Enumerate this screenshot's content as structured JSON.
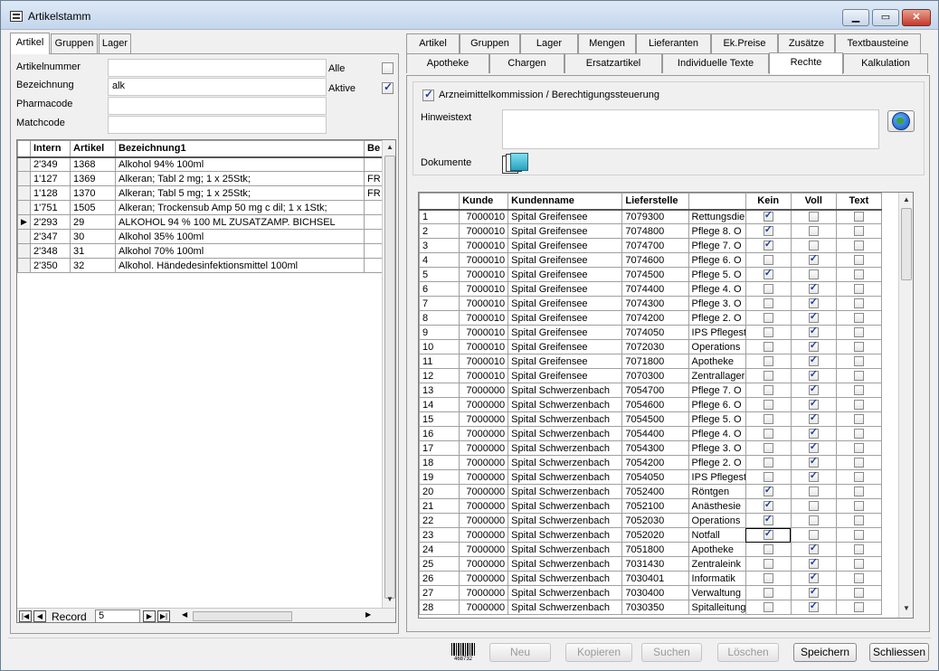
{
  "window": {
    "title": "Artikelstamm"
  },
  "left": {
    "tabs": [
      "Artikel",
      "Gruppen",
      "Lager"
    ],
    "fields": {
      "artikelnummer_label": "Artikelnummer",
      "artikelnummer_value": "",
      "bezeichnung_label": "Bezeichnung",
      "bezeichnung_value": "alk",
      "pharmacode_label": "Pharmacode",
      "pharmacode_value": "",
      "matchcode_label": "Matchcode",
      "matchcode_value": "",
      "alle_label": "Alle",
      "aktive_label": "Aktive",
      "alle_checked": false,
      "aktive_checked": true
    },
    "grid": {
      "headers": [
        "Intern",
        "Artikel",
        "Bezeichnung1",
        "Be"
      ],
      "rows": [
        [
          "2'349",
          "1368",
          "Alkohol 94% 100ml",
          ""
        ],
        [
          "1'127",
          "1369",
          "Alkeran; Tabl 2 mg; 1 x 25Stk;",
          "FR"
        ],
        [
          "1'128",
          "1370",
          "Alkeran; Tabl 5 mg; 1 x 25Stk;",
          "FR"
        ],
        [
          "1'751",
          "1505",
          "Alkeran; Trockensub Amp 50 mg c dil; 1 x 1Stk;",
          ""
        ],
        [
          "2'293",
          "29",
          "ALKOHOL 94 % 100 ML ZUSATZAMP. BICHSEL",
          ""
        ],
        [
          "2'347",
          "30",
          "Alkohol 35% 100ml",
          ""
        ],
        [
          "2'348",
          "31",
          "Alkohol 70% 100ml",
          ""
        ],
        [
          "2'350",
          "32",
          "Alkohol. Händedesinfektionsmittel 100ml",
          ""
        ]
      ],
      "current_row": 4
    },
    "nav": {
      "record_label": "Record",
      "record_value": "5"
    }
  },
  "right": {
    "tabs_row1": [
      "Artikel",
      "Gruppen",
      "Lager",
      "Mengen",
      "Lieferanten",
      "Ek.Preise",
      "Zusätze",
      "Textbausteine"
    ],
    "tabs_row2": [
      "Apotheke",
      "Chargen",
      "Ersatzartikel",
      "Individuelle Texte",
      "Rechte",
      "Kalkulation"
    ],
    "active_tab": "Rechte",
    "checkbox_label": "Arzneimittelkommission / Berechtigungssteuerung",
    "checkbox_checked": true,
    "hinweistext_label": "Hinweistext",
    "hinweistext_value": "",
    "dokumente_label": "Dokumente",
    "grid": {
      "headers": [
        "",
        "Kunde",
        "Kundenname",
        "Lieferstelle",
        "",
        "Kein",
        "Voll",
        "Text"
      ],
      "rows": [
        [
          "1",
          "7000010",
          "Spital Greifensee",
          "7079300",
          "Rettungsdie",
          true,
          false,
          false
        ],
        [
          "2",
          "7000010",
          "Spital Greifensee",
          "7074800",
          "Pflege 8. O",
          true,
          false,
          false
        ],
        [
          "3",
          "7000010",
          "Spital Greifensee",
          "7074700",
          "Pflege 7. O",
          true,
          false,
          false
        ],
        [
          "4",
          "7000010",
          "Spital Greifensee",
          "7074600",
          "Pflege 6. O",
          false,
          true,
          false
        ],
        [
          "5",
          "7000010",
          "Spital Greifensee",
          "7074500",
          "Pflege 5. O",
          true,
          false,
          false
        ],
        [
          "6",
          "7000010",
          "Spital Greifensee",
          "7074400",
          "Pflege 4. O",
          false,
          true,
          false
        ],
        [
          "7",
          "7000010",
          "Spital Greifensee",
          "7074300",
          "Pflege 3. O",
          false,
          true,
          false
        ],
        [
          "8",
          "7000010",
          "Spital Greifensee",
          "7074200",
          "Pflege 2. O",
          false,
          true,
          false
        ],
        [
          "9",
          "7000010",
          "Spital Greifensee",
          "7074050",
          "IPS Pflegest",
          false,
          true,
          false
        ],
        [
          "10",
          "7000010",
          "Spital Greifensee",
          "7072030",
          "Operations",
          false,
          true,
          false
        ],
        [
          "11",
          "7000010",
          "Spital Greifensee",
          "7071800",
          "Apotheke",
          false,
          true,
          false
        ],
        [
          "12",
          "7000010",
          "Spital Greifensee",
          "7070300",
          "Zentrallager",
          false,
          true,
          false
        ],
        [
          "13",
          "7000000",
          "Spital Schwerzenbach",
          "7054700",
          "Pflege 7. O",
          false,
          true,
          false
        ],
        [
          "14",
          "7000000",
          "Spital Schwerzenbach",
          "7054600",
          "Pflege 6. O",
          false,
          true,
          false
        ],
        [
          "15",
          "7000000",
          "Spital Schwerzenbach",
          "7054500",
          "Pflege 5. O",
          false,
          true,
          false
        ],
        [
          "16",
          "7000000",
          "Spital Schwerzenbach",
          "7054400",
          "Pflege 4. O",
          false,
          true,
          false
        ],
        [
          "17",
          "7000000",
          "Spital Schwerzenbach",
          "7054300",
          "Pflege 3. O",
          false,
          true,
          false
        ],
        [
          "18",
          "7000000",
          "Spital Schwerzenbach",
          "7054200",
          "Pflege 2. O",
          false,
          true,
          false
        ],
        [
          "19",
          "7000000",
          "Spital Schwerzenbach",
          "7054050",
          "IPS Pflegest",
          false,
          true,
          false
        ],
        [
          "20",
          "7000000",
          "Spital Schwerzenbach",
          "7052400",
          "Röntgen",
          true,
          false,
          false
        ],
        [
          "21",
          "7000000",
          "Spital Schwerzenbach",
          "7052100",
          "Anästhesie",
          true,
          false,
          false
        ],
        [
          "22",
          "7000000",
          "Spital Schwerzenbach",
          "7052030",
          "Operations",
          true,
          false,
          false
        ],
        [
          "23",
          "7000000",
          "Spital Schwerzenbach",
          "7052020",
          "Notfall",
          true,
          false,
          false
        ],
        [
          "24",
          "7000000",
          "Spital Schwerzenbach",
          "7051800",
          "Apotheke",
          false,
          true,
          false
        ],
        [
          "25",
          "7000000",
          "Spital Schwerzenbach",
          "7031430",
          "Zentraleink",
          false,
          true,
          false
        ],
        [
          "26",
          "7000000",
          "Spital Schwerzenbach",
          "7030401",
          "Informatik",
          false,
          true,
          false
        ],
        [
          "27",
          "7000000",
          "Spital Schwerzenbach",
          "7030400",
          "Verwaltung",
          false,
          true,
          false
        ],
        [
          "28",
          "7000000",
          "Spital Schwerzenbach",
          "7030350",
          "Spitalleitung",
          false,
          true,
          false
        ]
      ]
    }
  },
  "footer": {
    "barcode_text": "468732",
    "buttons": [
      {
        "label": "Neu",
        "enabled": false
      },
      {
        "label": "Kopieren",
        "enabled": false
      },
      {
        "label": "Suchen",
        "enabled": false
      },
      {
        "label": "Löschen",
        "enabled": false
      },
      {
        "label": "Speichern",
        "enabled": true
      },
      {
        "label": "Schliessen",
        "enabled": true
      }
    ]
  }
}
